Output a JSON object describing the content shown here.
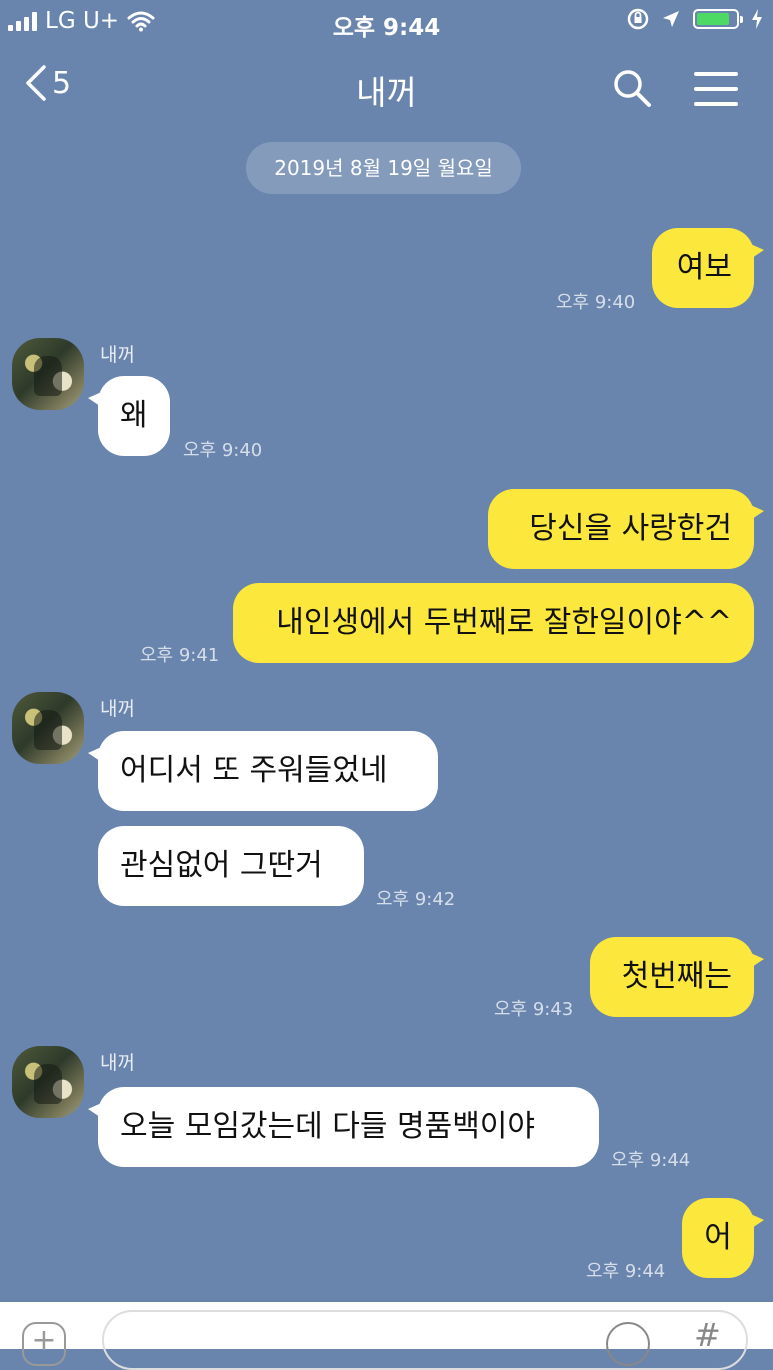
{
  "status_bar": {
    "carrier": "LG U+",
    "time": "오후 9:44",
    "battery_level": 0.85,
    "colors": {
      "battery_fill": "#4cd964"
    }
  },
  "nav": {
    "back_count": "5",
    "title": "내꺼"
  },
  "date_divider": "2019년 8월 19일 월요일",
  "contact_name": "내꺼",
  "messages": [
    {
      "side": "me",
      "text": "여보",
      "time": "오후 9:40"
    },
    {
      "side": "other",
      "text": "왜",
      "time": "오후 9:40"
    },
    {
      "side": "me",
      "text": "당신을 사랑한건"
    },
    {
      "side": "me",
      "text": "내인생에서 두번째로 잘한일이야^^",
      "time": "오후 9:41"
    },
    {
      "side": "other",
      "text": "어디서 또 주워들었네"
    },
    {
      "side": "other",
      "text": "관심없어 그딴거",
      "time": "오후 9:42"
    },
    {
      "side": "me",
      "text": "첫번째는",
      "time": "오후 9:43"
    },
    {
      "side": "other",
      "text": "오늘 모임갔는데 다들 명품백이야",
      "time": "오후 9:44"
    },
    {
      "side": "me",
      "text": "어",
      "time": "오후 9:44"
    }
  ],
  "composer": {
    "hash_label": "#"
  },
  "colors": {
    "background": "#6985ae",
    "my_bubble": "#fce73d",
    "their_bubble": "#ffffff"
  }
}
